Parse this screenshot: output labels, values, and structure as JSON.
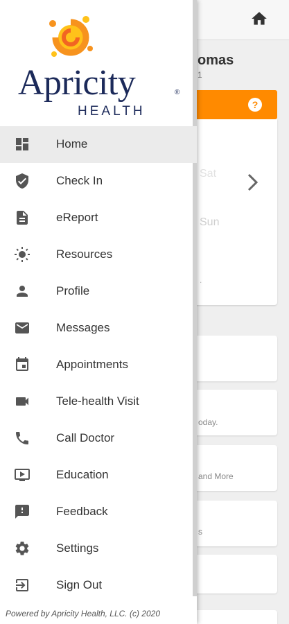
{
  "background": {
    "patient_name": "omas",
    "patient_sub": "1",
    "help_glyph": "?",
    "calendar": {
      "day_sat": "Sat",
      "day_sun": "Sun",
      "dot": "."
    },
    "cards": [
      {
        "text": ""
      },
      {
        "text": "oday."
      },
      {
        "text": "and More"
      },
      {
        "text": "s"
      },
      {
        "text": ""
      },
      {
        "text": ""
      }
    ]
  },
  "drawer": {
    "logo": {
      "word": "Apricity",
      "reg": "®",
      "health": "HEALTH"
    },
    "menu": [
      {
        "label": "Home",
        "icon": "dashboard-icon"
      },
      {
        "label": "Check In",
        "icon": "shield-check-icon"
      },
      {
        "label": "eReport",
        "icon": "document-icon"
      },
      {
        "label": "Resources",
        "icon": "sun-icon"
      },
      {
        "label": "Profile",
        "icon": "person-icon"
      },
      {
        "label": "Messages",
        "icon": "mail-icon"
      },
      {
        "label": "Appointments",
        "icon": "calendar-icon"
      },
      {
        "label": "Tele-health Visit",
        "icon": "video-camera-icon"
      },
      {
        "label": "Call Doctor",
        "icon": "phone-icon"
      },
      {
        "label": "Education",
        "icon": "video-play-icon"
      },
      {
        "label": "Feedback",
        "icon": "feedback-icon"
      },
      {
        "label": "Settings",
        "icon": "gear-icon"
      },
      {
        "label": "Sign Out",
        "icon": "sign-out-icon"
      }
    ],
    "active_item": "Home",
    "footer": "Powered by Apricity Health, LLC. (c) 2020"
  },
  "colors": {
    "accent": "#ff8a00",
    "brand_navy": "#1c2a5a",
    "icon": "#555555"
  }
}
